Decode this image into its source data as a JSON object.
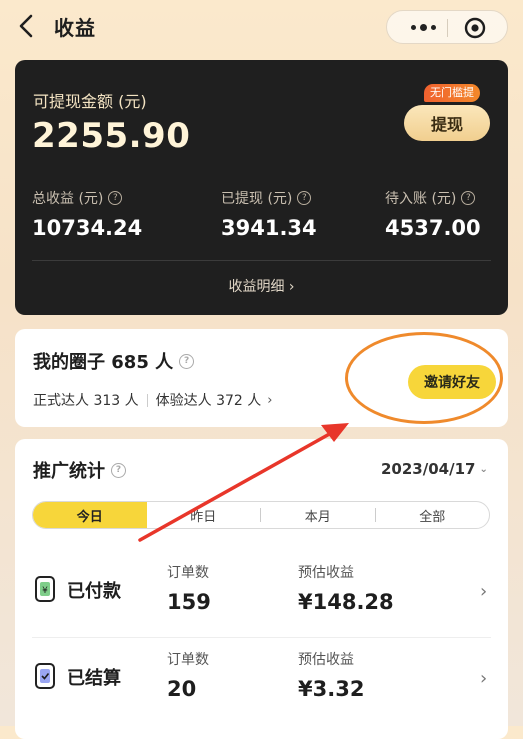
{
  "header": {
    "title": "收益"
  },
  "earnings": {
    "available_label": "可提现金额 (元)",
    "available_amount": "2255.90",
    "badge": "无门槛提",
    "withdraw_button": "提现",
    "stats": [
      {
        "label": "总收益 (元)",
        "value": "10734.24"
      },
      {
        "label": "已提现 (元)",
        "value": "3941.34"
      },
      {
        "label": "待入账 (元)",
        "value": "4537.00"
      }
    ],
    "detail_link": "收益明细 ›"
  },
  "circle": {
    "title": "我的圈子 685 人",
    "formal": "正式达人 313 人",
    "trial": "体验达人 372 人",
    "invite_button": "邀请好友"
  },
  "promotion": {
    "title": "推广统计",
    "date": "2023/04/17",
    "tabs": [
      "今日",
      "昨日",
      "本月",
      "全部"
    ],
    "active_tab": "今日",
    "rows": [
      {
        "name": "已付款",
        "orders_label": "订单数",
        "orders": "159",
        "est_label": "预估收益",
        "est": "¥148.28"
      },
      {
        "name": "已结算",
        "orders_label": "订单数",
        "orders": "20",
        "est_label": "预估收益",
        "est": "¥3.32"
      }
    ]
  },
  "colors": {
    "accent_yellow": "#f7d63a",
    "dark_card": "#1f1f1f",
    "annotation_red": "#e8362a",
    "annotation_orange": "#ef8a2c"
  },
  "icons": [
    "back-arrow-icon",
    "more-dots-icon",
    "close-target-icon",
    "question-icon",
    "chevron-right-icon",
    "wallet-icon",
    "settled-icon"
  ]
}
